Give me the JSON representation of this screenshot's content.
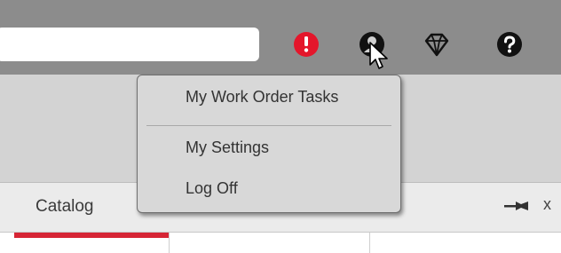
{
  "header": {
    "search": {
      "value": "",
      "placeholder": ""
    },
    "icons": [
      {
        "name": "alert-icon",
        "color": "#e4162b"
      },
      {
        "name": "user-icon",
        "color": "#111111"
      },
      {
        "name": "diamond-icon",
        "color": "#111111"
      },
      {
        "name": "help-icon",
        "color": "#111111"
      }
    ]
  },
  "user_menu": {
    "items": [
      {
        "label": "My Work Order Tasks"
      },
      {
        "label": "My Settings"
      },
      {
        "label": "Log Off"
      }
    ]
  },
  "panel": {
    "tab_label": "Catalog",
    "close_label": "x"
  },
  "colors": {
    "topbar": "#8c8c8c",
    "band": "#d3d3d3",
    "menu_bg": "#d8d8d8",
    "accent_red": "#d62535"
  }
}
